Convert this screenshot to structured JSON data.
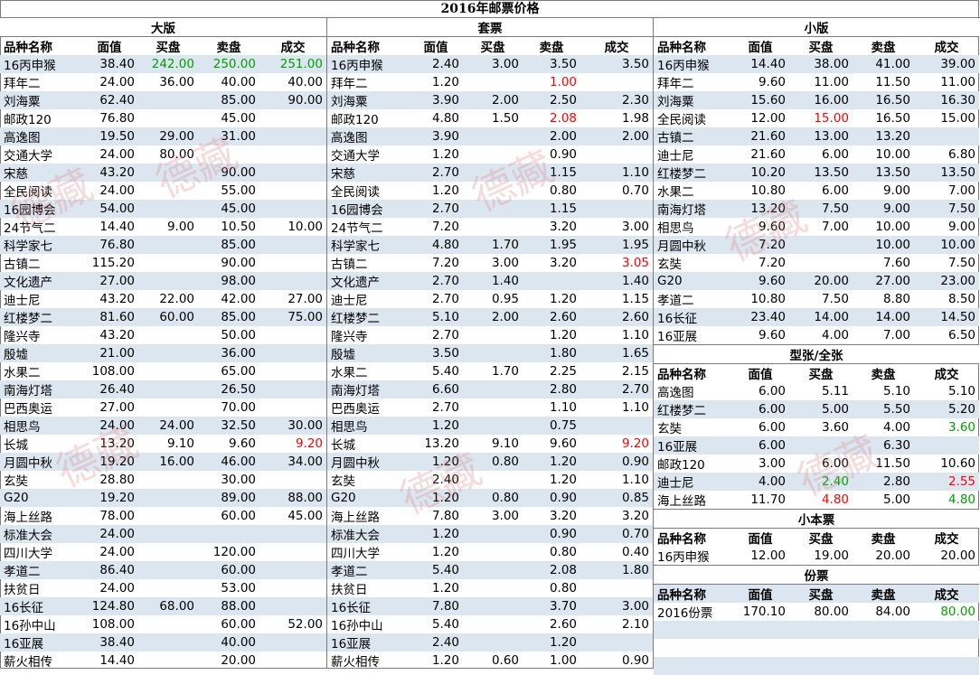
{
  "title": "2016年邮票价格",
  "header": [
    "品种名称",
    "面值",
    "买盘",
    "卖盘",
    "成交"
  ],
  "colors": {
    "stripe": "#dce6f1",
    "red": "#ff0000",
    "green": "#00a000",
    "border": "#7a7a7a"
  },
  "watermark": "德藏",
  "big": {
    "title": "大版",
    "rows": [
      {
        "name": "16丙申猴",
        "face": "38.40",
        "bid": "242.00",
        "ask": "250.00",
        "deal": "251.00",
        "c": {
          "bid": "green",
          "ask": "green",
          "deal": "green"
        }
      },
      {
        "name": "拜年二",
        "face": "24.00",
        "bid": "36.00",
        "ask": "40.00",
        "deal": "40.00"
      },
      {
        "name": "刘海粟",
        "face": "62.40",
        "bid": "",
        "ask": "85.00",
        "deal": "90.00"
      },
      {
        "name": "邮政120",
        "face": "76.80",
        "bid": "",
        "ask": "45.00",
        "deal": ""
      },
      {
        "name": "高逸图",
        "face": "19.50",
        "bid": "29.00",
        "ask": "31.00",
        "deal": ""
      },
      {
        "name": "交通大学",
        "face": "24.00",
        "bid": "80.00",
        "ask": "",
        "deal": ""
      },
      {
        "name": "宋慈",
        "face": "43.20",
        "bid": "",
        "ask": "90.00",
        "deal": ""
      },
      {
        "name": "全民阅读",
        "face": "24.00",
        "bid": "",
        "ask": "55.00",
        "deal": ""
      },
      {
        "name": "16园博会",
        "face": "54.00",
        "bid": "",
        "ask": "45.00",
        "deal": ""
      },
      {
        "name": "24节气二",
        "face": "14.40",
        "bid": "9.00",
        "ask": "10.50",
        "deal": "10.00"
      },
      {
        "name": "科学家七",
        "face": "76.80",
        "bid": "",
        "ask": "85.00",
        "deal": ""
      },
      {
        "name": "古镇二",
        "face": "115.20",
        "bid": "",
        "ask": "90.00",
        "deal": ""
      },
      {
        "name": "文化遗产",
        "face": "27.00",
        "bid": "",
        "ask": "98.00",
        "deal": ""
      },
      {
        "name": "迪士尼",
        "face": "43.20",
        "bid": "22.00",
        "ask": "42.00",
        "deal": "27.00"
      },
      {
        "name": "红楼梦二",
        "face": "81.60",
        "bid": "60.00",
        "ask": "85.00",
        "deal": "75.00"
      },
      {
        "name": "隆兴寺",
        "face": "43.20",
        "bid": "",
        "ask": "50.00",
        "deal": ""
      },
      {
        "name": "殷墟",
        "face": "21.00",
        "bid": "",
        "ask": "36.00",
        "deal": ""
      },
      {
        "name": "水果二",
        "face": "108.00",
        "bid": "",
        "ask": "65.00",
        "deal": ""
      },
      {
        "name": "南海灯塔",
        "face": "26.40",
        "bid": "",
        "ask": "26.50",
        "deal": ""
      },
      {
        "name": "巴西奥运",
        "face": "27.00",
        "bid": "",
        "ask": "70.00",
        "deal": ""
      },
      {
        "name": "相思鸟",
        "face": "24.00",
        "bid": "24.00",
        "ask": "32.50",
        "deal": "30.00"
      },
      {
        "name": "长城",
        "face": "13.20",
        "bid": "9.10",
        "ask": "9.60",
        "deal": "9.20",
        "c": {
          "deal": "red"
        }
      },
      {
        "name": "月圆中秋",
        "face": "19.20",
        "bid": "16.00",
        "ask": "46.00",
        "deal": "34.00"
      },
      {
        "name": "玄奘",
        "face": "28.80",
        "bid": "",
        "ask": "30.00",
        "deal": ""
      },
      {
        "name": "G20",
        "face": "19.20",
        "bid": "",
        "ask": "89.00",
        "deal": "88.00"
      },
      {
        "name": "海上丝路",
        "face": "78.00",
        "bid": "",
        "ask": "60.00",
        "deal": "45.00"
      },
      {
        "name": "标准大会",
        "face": "24.00",
        "bid": "",
        "ask": "",
        "deal": ""
      },
      {
        "name": "四川大学",
        "face": "24.00",
        "bid": "",
        "ask": "120.00",
        "deal": ""
      },
      {
        "name": "孝道二",
        "face": "86.40",
        "bid": "",
        "ask": "60.00",
        "deal": ""
      },
      {
        "name": "扶贫日",
        "face": "24.00",
        "bid": "",
        "ask": "53.00",
        "deal": ""
      },
      {
        "name": "16长征",
        "face": "124.80",
        "bid": "68.00",
        "ask": "88.00",
        "deal": ""
      },
      {
        "name": "16孙中山",
        "face": "108.00",
        "bid": "",
        "ask": "60.00",
        "deal": "52.00"
      },
      {
        "name": "16亚展",
        "face": "38.40",
        "bid": "",
        "ask": "40.00",
        "deal": ""
      },
      {
        "name": "薪火相传",
        "face": "14.40",
        "bid": "",
        "ask": "20.00",
        "deal": ""
      }
    ]
  },
  "set": {
    "title": "套票",
    "rows": [
      {
        "name": "16丙申猴",
        "face": "2.40",
        "bid": "3.00",
        "ask": "3.50",
        "deal": "3.50"
      },
      {
        "name": "拜年二",
        "face": "1.20",
        "bid": "",
        "ask": "1.00",
        "deal": "",
        "c": {
          "ask": "red"
        }
      },
      {
        "name": "刘海粟",
        "face": "3.90",
        "bid": "2.00",
        "ask": "2.50",
        "deal": "2.30"
      },
      {
        "name": "邮政120",
        "face": "4.80",
        "bid": "1.50",
        "ask": "2.08",
        "deal": "1.98",
        "c": {
          "ask": "red"
        }
      },
      {
        "name": "高逸图",
        "face": "3.90",
        "bid": "",
        "ask": "2.00",
        "deal": "2.00"
      },
      {
        "name": "交通大学",
        "face": "1.20",
        "bid": "",
        "ask": "0.90",
        "deal": ""
      },
      {
        "name": "宋慈",
        "face": "2.70",
        "bid": "",
        "ask": "1.15",
        "deal": "1.10"
      },
      {
        "name": "全民阅读",
        "face": "1.20",
        "bid": "",
        "ask": "0.80",
        "deal": "0.70"
      },
      {
        "name": "16园博会",
        "face": "2.70",
        "bid": "",
        "ask": "1.15",
        "deal": ""
      },
      {
        "name": "24节气二",
        "face": "7.20",
        "bid": "",
        "ask": "3.20",
        "deal": "3.00"
      },
      {
        "name": "科学家七",
        "face": "4.80",
        "bid": "1.70",
        "ask": "1.95",
        "deal": "1.95"
      },
      {
        "name": "古镇二",
        "face": "7.20",
        "bid": "3.00",
        "ask": "3.20",
        "deal": "3.05",
        "c": {
          "deal": "red"
        }
      },
      {
        "name": "文化遗产",
        "face": "2.70",
        "bid": "1.40",
        "ask": "",
        "deal": "1.40"
      },
      {
        "name": "迪士尼",
        "face": "2.70",
        "bid": "0.95",
        "ask": "1.20",
        "deal": "1.15"
      },
      {
        "name": "红楼梦二",
        "face": "5.10",
        "bid": "2.00",
        "ask": "2.60",
        "deal": "2.60"
      },
      {
        "name": "隆兴寺",
        "face": "2.70",
        "bid": "",
        "ask": "1.20",
        "deal": "1.10"
      },
      {
        "name": "殷墟",
        "face": "3.50",
        "bid": "",
        "ask": "1.80",
        "deal": "1.65"
      },
      {
        "name": "水果二",
        "face": "5.40",
        "bid": "1.70",
        "ask": "2.25",
        "deal": "2.15"
      },
      {
        "name": "南海灯塔",
        "face": "6.60",
        "bid": "",
        "ask": "2.80",
        "deal": "2.70"
      },
      {
        "name": "巴西奥运",
        "face": "2.70",
        "bid": "",
        "ask": "1.10",
        "deal": "1.10"
      },
      {
        "name": "相思鸟",
        "face": "1.20",
        "bid": "",
        "ask": "0.75",
        "deal": ""
      },
      {
        "name": "长城",
        "face": "13.20",
        "bid": "9.10",
        "ask": "9.60",
        "deal": "9.20",
        "c": {
          "deal": "red"
        }
      },
      {
        "name": "月圆中秋",
        "face": "1.20",
        "bid": "0.80",
        "ask": "1.20",
        "deal": "0.90"
      },
      {
        "name": "玄奘",
        "face": "2.40",
        "bid": "",
        "ask": "1.20",
        "deal": "1.10"
      },
      {
        "name": "G20",
        "face": "1.20",
        "bid": "0.80",
        "ask": "0.90",
        "deal": "0.85"
      },
      {
        "name": "海上丝路",
        "face": "7.80",
        "bid": "3.00",
        "ask": "3.20",
        "deal": "3.20"
      },
      {
        "name": "标准大会",
        "face": "1.20",
        "bid": "",
        "ask": "0.90",
        "deal": "0.70"
      },
      {
        "name": "四川大学",
        "face": "1.20",
        "bid": "",
        "ask": "0.80",
        "deal": "0.40"
      },
      {
        "name": "孝道二",
        "face": "5.40",
        "bid": "",
        "ask": "2.08",
        "deal": "1.80"
      },
      {
        "name": "扶贫日",
        "face": "1.20",
        "bid": "",
        "ask": "0.80",
        "deal": ""
      },
      {
        "name": "16长征",
        "face": "7.80",
        "bid": "",
        "ask": "3.70",
        "deal": "3.00"
      },
      {
        "name": "16孙中山",
        "face": "5.40",
        "bid": "",
        "ask": "2.60",
        "deal": "2.10"
      },
      {
        "name": "16亚展",
        "face": "2.40",
        "bid": "",
        "ask": "1.20",
        "deal": ""
      },
      {
        "name": "薪火相传",
        "face": "1.20",
        "bid": "0.60",
        "ask": "1.00",
        "deal": "0.90"
      }
    ]
  },
  "small": {
    "title": "小版",
    "rows": [
      {
        "name": "16丙申猴",
        "face": "14.40",
        "bid": "38.00",
        "ask": "41.00",
        "deal": "39.00"
      },
      {
        "name": "拜年二",
        "face": "9.60",
        "bid": "11.00",
        "ask": "11.50",
        "deal": "11.00"
      },
      {
        "name": "刘海粟",
        "face": "15.60",
        "bid": "16.00",
        "ask": "16.50",
        "deal": "16.30"
      },
      {
        "name": "全民阅读",
        "face": "12.00",
        "bid": "15.00",
        "ask": "16.50",
        "deal": "15.00",
        "c": {
          "bid": "red"
        }
      },
      {
        "name": "古镇二",
        "face": "21.60",
        "bid": "13.00",
        "ask": "13.20",
        "deal": ""
      },
      {
        "name": "迪士尼",
        "face": "21.60",
        "bid": "6.00",
        "ask": "10.00",
        "deal": "6.80"
      },
      {
        "name": "红楼梦二",
        "face": "10.20",
        "bid": "13.50",
        "ask": "13.50",
        "deal": "13.50"
      },
      {
        "name": "水果二",
        "face": "10.80",
        "bid": "6.00",
        "ask": "9.00",
        "deal": "7.00"
      },
      {
        "name": "南海灯塔",
        "face": "13.20",
        "bid": "7.50",
        "ask": "9.00",
        "deal": "7.50"
      },
      {
        "name": "相思鸟",
        "face": "9.60",
        "bid": "7.00",
        "ask": "10.00",
        "deal": "9.00"
      },
      {
        "name": "月圆中秋",
        "face": "7.20",
        "bid": "",
        "ask": "10.00",
        "deal": "10.00"
      },
      {
        "name": "玄奘",
        "face": "7.20",
        "bid": "",
        "ask": "7.60",
        "deal": "7.50"
      },
      {
        "name": "G20",
        "face": "9.60",
        "bid": "20.00",
        "ask": "27.00",
        "deal": "23.00"
      },
      {
        "name": "孝道二",
        "face": "10.80",
        "bid": "7.50",
        "ask": "8.80",
        "deal": "8.50"
      },
      {
        "name": "16长征",
        "face": "23.40",
        "bid": "14.00",
        "ask": "14.00",
        "deal": "14.50"
      },
      {
        "name": "16亚展",
        "face": "9.60",
        "bid": "4.00",
        "ask": "7.00",
        "deal": "6.50"
      }
    ]
  },
  "sheet": {
    "title": "型张/全张",
    "rows": [
      {
        "name": "高逸图",
        "face": "6.00",
        "bid": "5.11",
        "ask": "5.10",
        "deal": "5.10"
      },
      {
        "name": "红楼梦二",
        "face": "6.00",
        "bid": "5.00",
        "ask": "5.50",
        "deal": "5.20"
      },
      {
        "name": "玄奘",
        "face": "6.00",
        "bid": "3.60",
        "ask": "4.00",
        "deal": "3.60",
        "c": {
          "deal": "green"
        }
      },
      {
        "name": "16亚展",
        "face": "6.00",
        "bid": "",
        "ask": "6.30",
        "deal": ""
      },
      {
        "name": "邮政120",
        "face": "3.00",
        "bid": "6.00",
        "ask": "11.50",
        "deal": "10.60"
      },
      {
        "name": "迪士尼",
        "face": "4.00",
        "bid": "2.40",
        "ask": "2.80",
        "deal": "2.55",
        "c": {
          "bid": "green",
          "deal": "red"
        }
      },
      {
        "name": "海上丝路",
        "face": "11.70",
        "bid": "4.80",
        "ask": "5.00",
        "deal": "4.80",
        "c": {
          "bid": "red",
          "deal": "green"
        }
      }
    ]
  },
  "booklet": {
    "title": "小本票",
    "rows": [
      {
        "name": "16丙申猴",
        "face": "12.00",
        "bid": "19.00",
        "ask": "20.00",
        "deal": "20.00"
      }
    ]
  },
  "yearset": {
    "title": "份票",
    "rows": [
      {
        "name": "2016份票",
        "face": "170.10",
        "bid": "80.00",
        "ask": "84.00",
        "deal": "80.00",
        "c": {
          "deal": "green"
        }
      }
    ]
  }
}
